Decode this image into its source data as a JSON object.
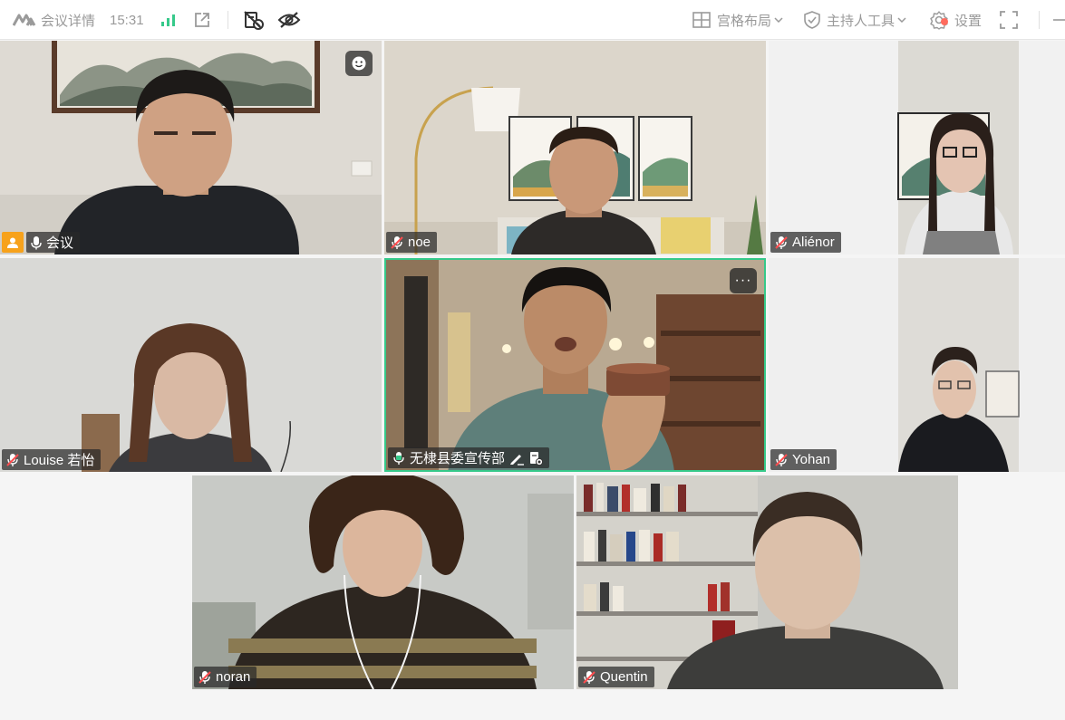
{
  "topbar": {
    "meeting_details": "会议详情",
    "time": "15:31",
    "layout_label": "宫格布局",
    "host_tools_label": "主持人工具",
    "settings_label": "设置"
  },
  "participants": [
    {
      "name": "会议",
      "is_host": true,
      "mic": "on"
    },
    {
      "name": "noe",
      "mic": "muted"
    },
    {
      "name": "Aliénor",
      "mic": "muted"
    },
    {
      "name": "Louise 若怡",
      "mic": "muted"
    },
    {
      "name": "无棣县委宣传部",
      "mic": "speaking",
      "active": true
    },
    {
      "name": "Yohan",
      "mic": "muted"
    },
    {
      "name": "noran",
      "mic": "muted"
    },
    {
      "name": "Quentin",
      "mic": "muted"
    }
  ],
  "colors": {
    "accent_green": "#36c98a",
    "host_badge": "#f7a21b",
    "mute_red": "#ff4d4f",
    "toolbar_icon_dark": "#333333"
  }
}
